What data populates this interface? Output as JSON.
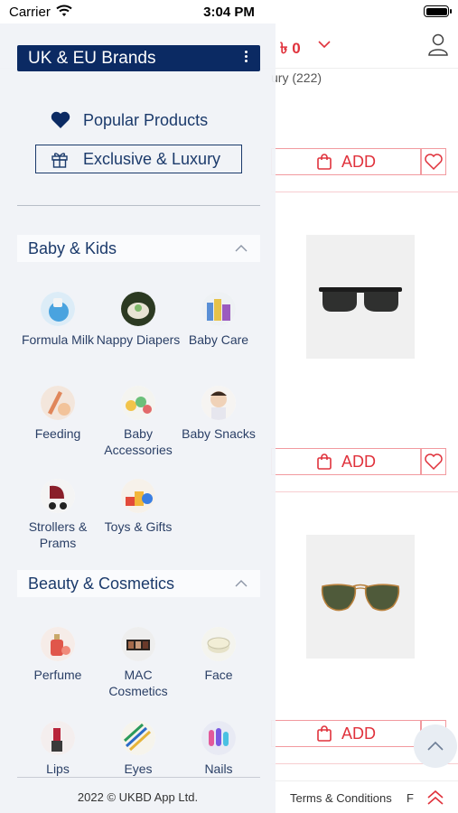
{
  "status_bar": {
    "carrier": "Carrier",
    "time": "3:04 PM"
  },
  "background": {
    "currency": "৳ 0",
    "results_text": "ury (222)",
    "add_label": "ADD",
    "footer_terms": "Terms & Conditions",
    "footer_cut": "F"
  },
  "drawer": {
    "brand_title": "UK & EU Brands",
    "popular_label": "Popular Products",
    "luxury_label": "Exclusive & Luxury",
    "sections": [
      {
        "title": "Baby & Kids",
        "items": [
          {
            "label": "Formula Milk",
            "icon": "formula-milk-icon"
          },
          {
            "label": "Nappy Diapers",
            "icon": "nappy-diapers-icon"
          },
          {
            "label": "Baby Care",
            "icon": "baby-care-icon"
          },
          {
            "label": "Feeding",
            "icon": "feeding-icon"
          },
          {
            "label": "Baby Accessories",
            "icon": "baby-accessories-icon"
          },
          {
            "label": "Baby Snacks",
            "icon": "baby-snacks-icon"
          },
          {
            "label": "Strollers & Prams",
            "icon": "strollers-prams-icon"
          },
          {
            "label": "Toys & Gifts",
            "icon": "toys-gifts-icon"
          }
        ]
      },
      {
        "title": "Beauty & Cosmetics",
        "items": [
          {
            "label": "Perfume",
            "icon": "perfume-icon"
          },
          {
            "label": "MAC Cosmetics",
            "icon": "mac-cosmetics-icon"
          },
          {
            "label": "Face",
            "icon": "face-icon"
          },
          {
            "label": "Lips",
            "icon": "lips-icon"
          },
          {
            "label": "Eyes",
            "icon": "eyes-icon"
          },
          {
            "label": "Nails",
            "icon": "nails-icon"
          }
        ]
      }
    ],
    "copyright": "2022 © UKBD App Ltd."
  },
  "colors": {
    "navy": "#0b2a63",
    "accent_red": "#e0323c",
    "drawer_bg": "#f0f2f6"
  }
}
